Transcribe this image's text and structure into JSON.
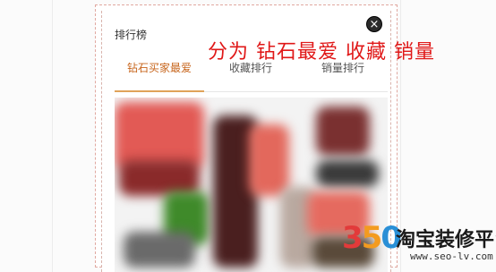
{
  "widget": {
    "title": "排行榜",
    "close_glyph": "×",
    "tabs": [
      {
        "label": "钻石买家最爱",
        "active": true
      },
      {
        "label": "收藏排行",
        "active": false
      },
      {
        "label": "销量排行",
        "active": false
      }
    ]
  },
  "annotation": {
    "text": "分为 钻石最爱 收藏 销量",
    "color": "#e01818"
  },
  "watermark": {
    "number": "350",
    "name": "淘宝装修平台",
    "url": "www.seo-lv.com"
  },
  "colors": {
    "tab_active": "#c7651c",
    "tab_underline": "#e0a35a",
    "edit_frame": "#e0a8a0"
  }
}
